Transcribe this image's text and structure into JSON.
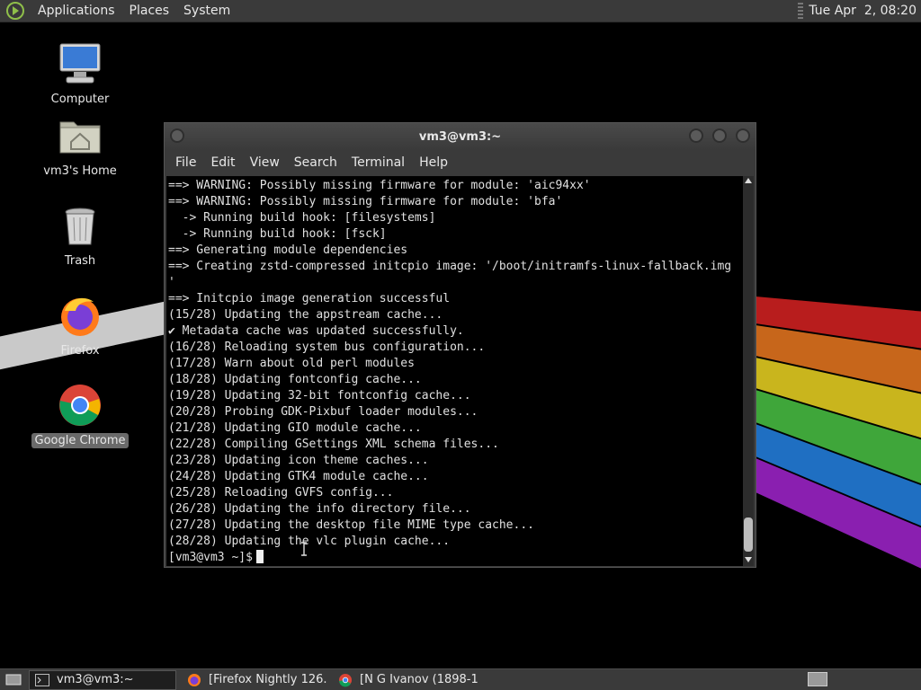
{
  "top_panel": {
    "menus": [
      "Applications",
      "Places",
      "System"
    ],
    "clock": "Tue Apr  2, 08:20"
  },
  "desktop": {
    "icons": [
      {
        "label": "Computer",
        "icon": "computer-icon"
      },
      {
        "label": "vm3's Home",
        "icon": "home-folder-icon"
      },
      {
        "label": "Trash",
        "icon": "trash-icon"
      },
      {
        "label": "Firefox",
        "icon": "firefox-icon"
      },
      {
        "label": "Google Chrome",
        "icon": "chrome-icon",
        "selected": true
      }
    ]
  },
  "terminal": {
    "title": "vm3@vm3:~",
    "menus": [
      "File",
      "Edit",
      "View",
      "Search",
      "Terminal",
      "Help"
    ],
    "lines": [
      "==> WARNING: Possibly missing firmware for module: 'aic94xx'",
      "==> WARNING: Possibly missing firmware for module: 'bfa'",
      "  -> Running build hook: [filesystems]",
      "  -> Running build hook: [fsck]",
      "==> Generating module dependencies",
      "==> Creating zstd-compressed initcpio image: '/boot/initramfs-linux-fallback.img",
      "'",
      "==> Initcpio image generation successful",
      "(15/28) Updating the appstream cache...",
      "✔ Metadata cache was updated successfully.",
      "(16/28) Reloading system bus configuration...",
      "(17/28) Warn about old perl modules",
      "(18/28) Updating fontconfig cache...",
      "(19/28) Updating 32-bit fontconfig cache...",
      "(20/28) Probing GDK-Pixbuf loader modules...",
      "(21/28) Updating GIO module cache...",
      "(22/28) Compiling GSettings XML schema files...",
      "(23/28) Updating icon theme caches...",
      "(24/28) Updating GTK4 module cache...",
      "(25/28) Reloading GVFS config...",
      "(26/28) Updating the info directory file...",
      "(27/28) Updating the desktop file MIME type cache...",
      "(28/28) Updating the vlc plugin cache..."
    ],
    "prompt": "[vm3@vm3 ~]$"
  },
  "taskbar": {
    "tasks": [
      {
        "label": "vm3@vm3:~",
        "icon": "terminal-icon",
        "active": true
      },
      {
        "label": "[Firefox Nightly 126....",
        "icon": "firefox-icon",
        "active": false
      },
      {
        "label": "[N G Ivanov (1898-1...",
        "icon": "chrome-icon",
        "active": false
      }
    ]
  },
  "colors": {
    "panel": "#3a3a3a",
    "terminal_bg": "#000000",
    "terminal_fg": "#e0e0e0",
    "stripes": [
      "#b81d1d",
      "#c7661b",
      "#c9b51d",
      "#3fa63a",
      "#1f6fc2",
      "#8a1fb0"
    ]
  }
}
